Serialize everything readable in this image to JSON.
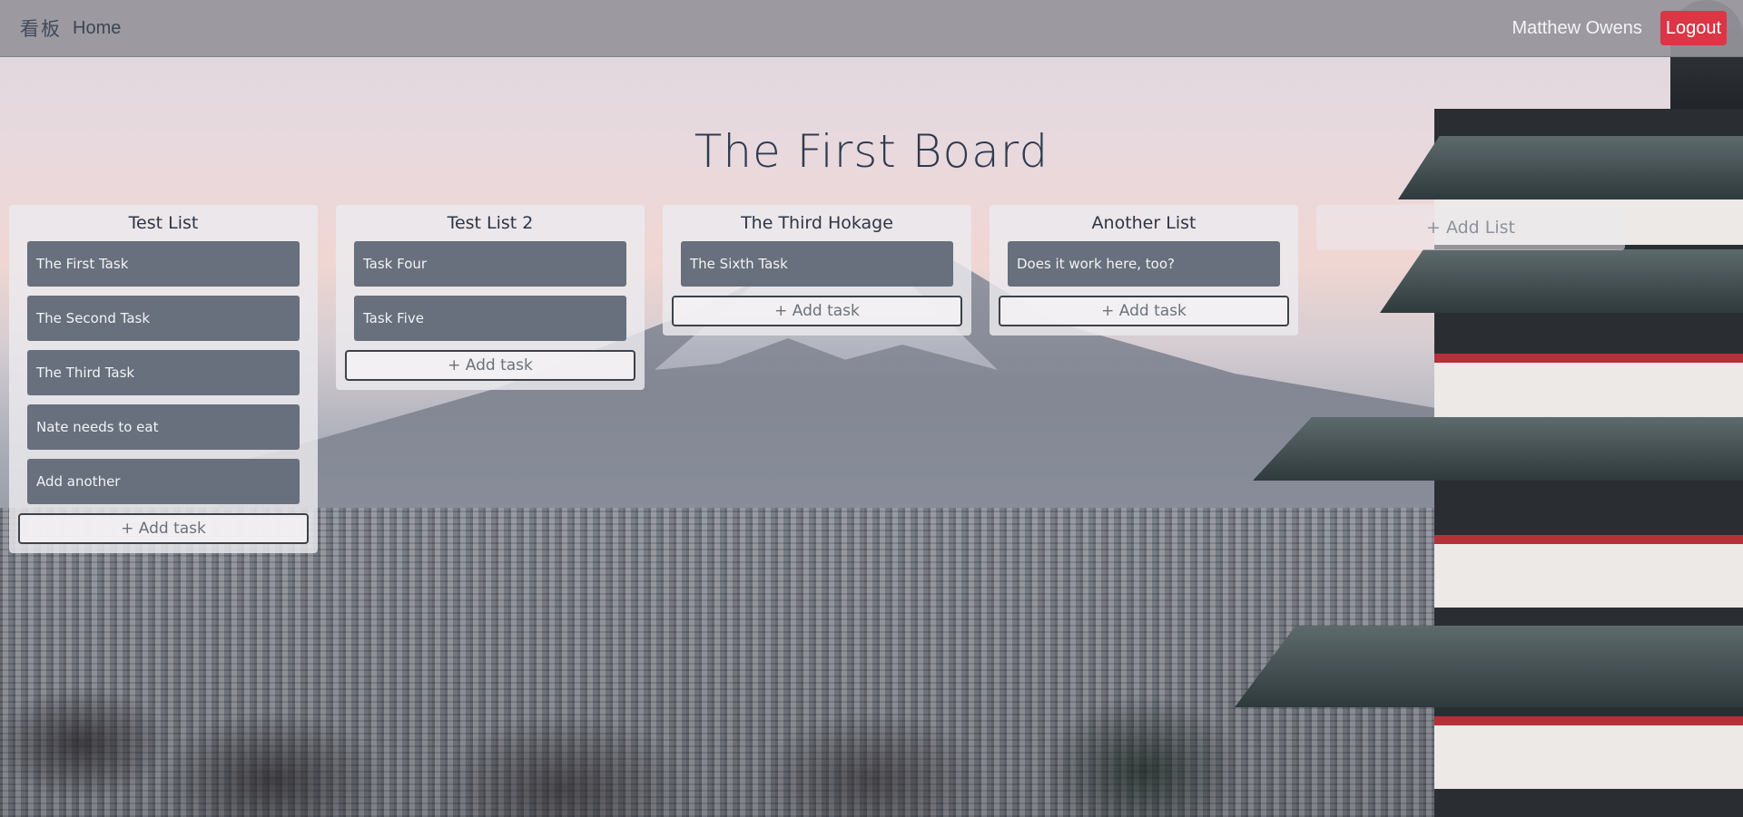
{
  "nav": {
    "logo": "看板",
    "home_label": "Home",
    "user_name": "Matthew Owens",
    "logout_label": "Logout"
  },
  "board": {
    "title": "The First Board",
    "add_list_label": "+ Add List",
    "lists": [
      {
        "title": "Test List",
        "tasks": [
          "The  First Task",
          "The Second Task",
          "The Third Task",
          "Nate needs to eat",
          "Add another"
        ],
        "add_task_label": "+ Add task"
      },
      {
        "title": "Test List 2",
        "tasks": [
          "Task Four",
          "Task Five"
        ],
        "add_task_label": "+ Add task"
      },
      {
        "title": "The Third Hokage",
        "tasks": [
          "The Sixth Task"
        ],
        "add_task_label": "+ Add task"
      },
      {
        "title": "Another List",
        "tasks": [
          "Does it work here, too?"
        ],
        "add_task_label": "+ Add task"
      }
    ]
  },
  "colors": {
    "logout_button": "#dc3545",
    "task_card": "#67707c",
    "title_text": "#2f3b4e"
  }
}
